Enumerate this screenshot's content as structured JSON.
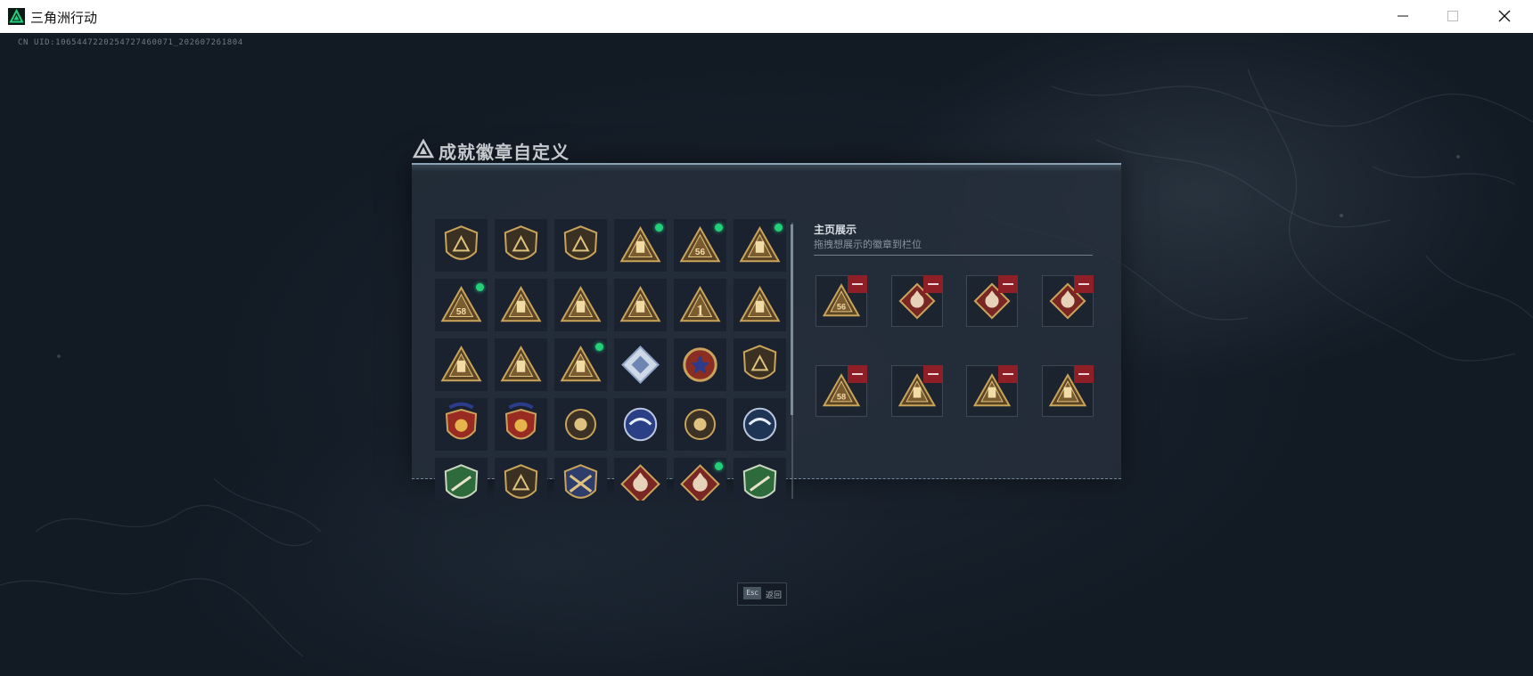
{
  "window": {
    "title": "三角洲行动",
    "controls": [
      "minimize",
      "maximize",
      "close"
    ]
  },
  "uid": "CN UID:1065447220254727460071_202607261804",
  "panel": {
    "title": "成就徽章自定义"
  },
  "badge_grid": {
    "rows": [
      [
        {
          "icon": "gold-shield-delta-badge",
          "new": false
        },
        {
          "icon": "helicopter-shield-badge",
          "new": false
        },
        {
          "icon": "winged-shield-badge",
          "new": false
        },
        {
          "icon": "triangle-vault-badge",
          "new": true
        },
        {
          "icon": "triangle-56-badge",
          "new": true
        },
        {
          "icon": "triangle-tower-badge",
          "new": true
        }
      ],
      [
        {
          "icon": "triangle-58-badge",
          "new": true
        },
        {
          "icon": "triangle-machine-badge",
          "new": false
        },
        {
          "icon": "triangle-hand-badge",
          "new": false
        },
        {
          "icon": "triangle-helmet-badge",
          "new": false
        },
        {
          "icon": "triangle-1-badge",
          "new": false
        },
        {
          "icon": "triangle-crate-badge",
          "new": false
        }
      ],
      [
        {
          "icon": "triangle-wing-badge",
          "new": false
        },
        {
          "icon": "triangle-turret-badge",
          "new": false
        },
        {
          "icon": "triangle-rocket-badge",
          "new": true
        },
        {
          "icon": "crystal-diamond-badge",
          "new": false
        },
        {
          "icon": "star-medal-badge",
          "new": false
        },
        {
          "icon": "chevron-shield-badge",
          "new": false
        }
      ],
      [
        {
          "icon": "red-star-shield-badge",
          "new": false
        },
        {
          "icon": "red-crest-shield-badge",
          "new": false
        },
        {
          "icon": "skull-round-badge",
          "new": false
        },
        {
          "icon": "blue-globe-badge",
          "new": false
        },
        {
          "icon": "gold-paw-round-badge",
          "new": false
        },
        {
          "icon": "blue-jet-badge",
          "new": false
        }
      ],
      [
        {
          "icon": "green-gun-shield-badge",
          "new": false
        },
        {
          "icon": "rifle-shield-badge",
          "new": false
        },
        {
          "icon": "crossed-guns-shield-badge",
          "new": false
        },
        {
          "icon": "red-wolf-badge",
          "new": false
        },
        {
          "icon": "red-wolf-badge-2",
          "new": true
        },
        {
          "icon": "green-eagle-badge",
          "new": false
        }
      ]
    ]
  },
  "showcase": {
    "title": "主页展示",
    "subtitle": "拖拽想展示的徽章到栏位",
    "slots": [
      {
        "icon": "triangle-56-badge"
      },
      {
        "icon": "red-horse-badge"
      },
      {
        "icon": "red-wolf-badge"
      },
      {
        "icon": "red-dragon-badge"
      },
      {
        "icon": "triangle-58-badge"
      },
      {
        "icon": "triangle-rocket-badge"
      },
      {
        "icon": "triangle-vault-badge"
      },
      {
        "icon": "triangle-tower-badge"
      }
    ]
  },
  "footer": {
    "esc_key": "Esc",
    "esc_label": "返回"
  },
  "colors": {
    "gold": "#c9a35a",
    "gold_dark": "#5a4424",
    "new_dot": "#23d07a",
    "remove": "#8f1f27",
    "brand_green": "#1fd37c"
  }
}
